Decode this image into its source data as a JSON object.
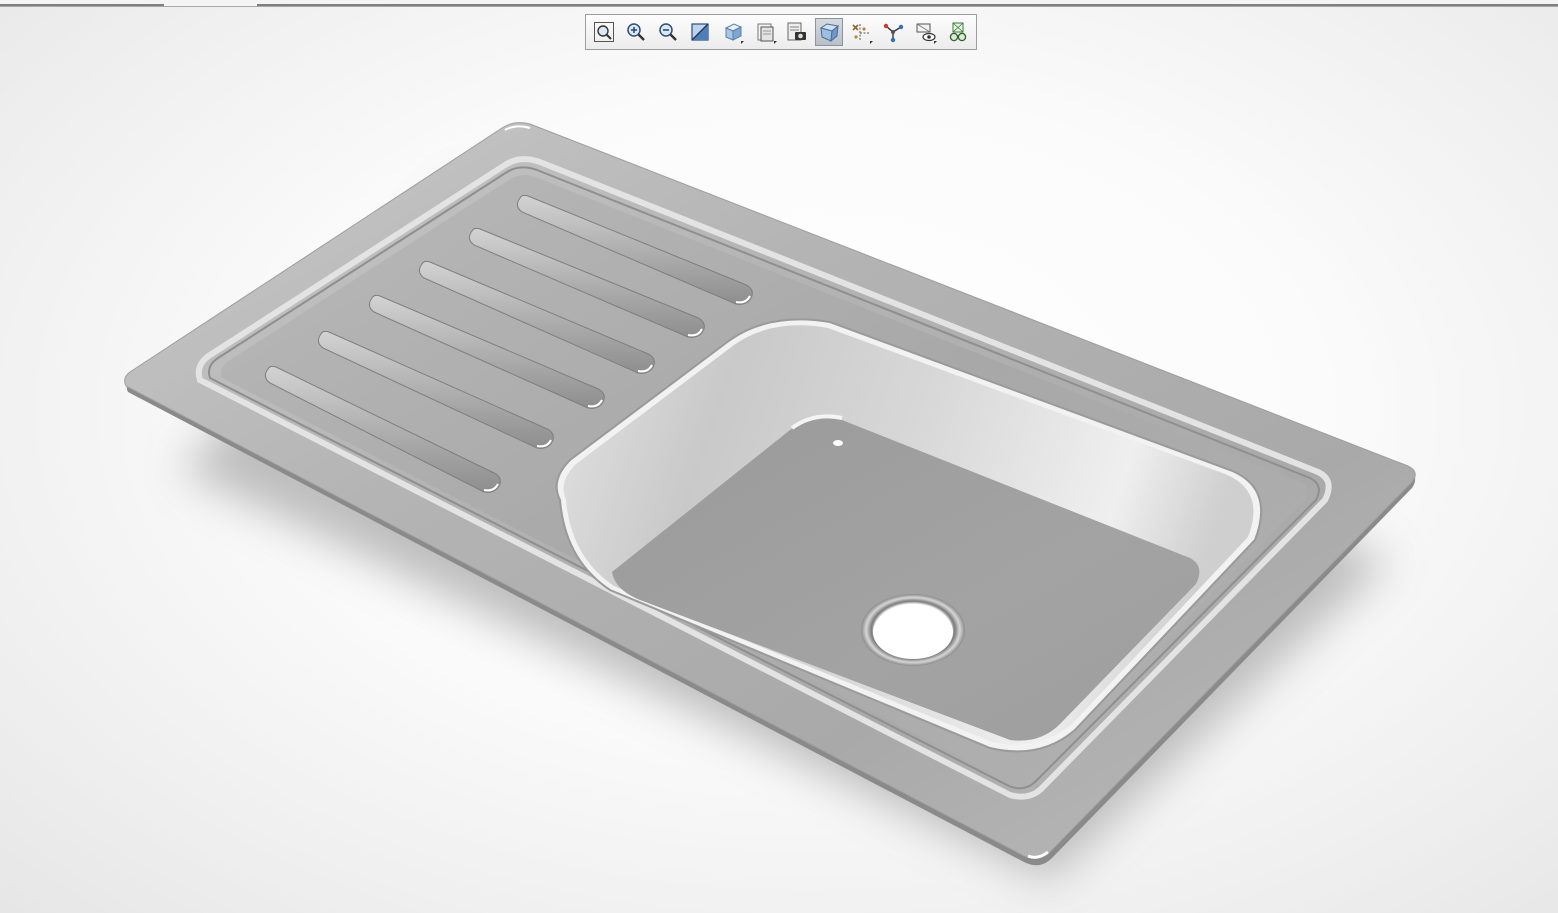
{
  "viewer": {
    "background_color": "#ffffff",
    "model_color": "#a9a9a9",
    "shadow_color": "#b9b9b9"
  },
  "toolbar": {
    "buttons": [
      {
        "id": "zoom-to-fit",
        "icon": "zoom-fit-icon",
        "active": false,
        "flyout": false
      },
      {
        "id": "zoom-in",
        "icon": "zoom-in-icon",
        "active": false,
        "flyout": false
      },
      {
        "id": "zoom-out",
        "icon": "zoom-out-icon",
        "active": false,
        "flyout": false
      },
      {
        "id": "section-view",
        "icon": "section-view-icon",
        "active": false,
        "flyout": false
      },
      {
        "id": "view-orientation",
        "icon": "view-cube-icon",
        "active": false,
        "flyout": true
      },
      {
        "id": "display-style",
        "icon": "display-style-icon",
        "active": false,
        "flyout": true
      },
      {
        "id": "snapshot",
        "icon": "snapshot-camera-icon",
        "active": false,
        "flyout": false
      },
      {
        "id": "perspective",
        "icon": "perspective-box-icon",
        "active": true,
        "flyout": false
      },
      {
        "id": "explode",
        "icon": "explode-lines-icon",
        "active": false,
        "flyout": true
      },
      {
        "id": "model-tree",
        "icon": "model-tree-icon",
        "active": false,
        "flyout": false
      },
      {
        "id": "hide-show",
        "icon": "hide-show-eye-icon",
        "active": false,
        "flyout": true
      },
      {
        "id": "glasses-3d",
        "icon": "glasses-3d-icon",
        "active": false,
        "flyout": false
      }
    ]
  }
}
